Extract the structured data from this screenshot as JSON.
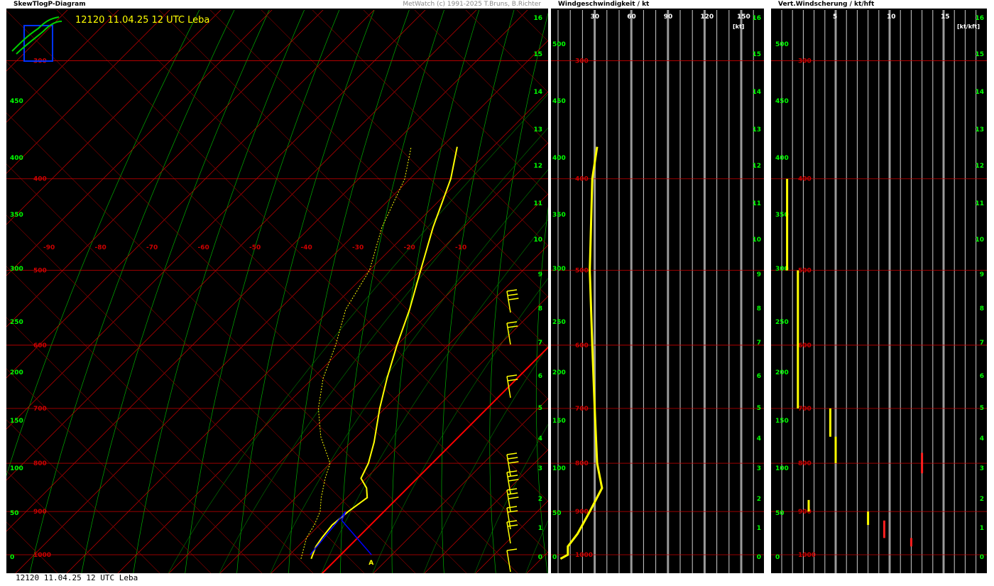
{
  "skewt": {
    "title": "SkewTlogP-Diagram",
    "copyright": "MetWatch (c) 1991-2025 T.Bruns, B.Richter",
    "station_title": "12120 11.04.25 12 UTC Leba"
  },
  "wind_panel": {
    "title": "Windgeschwindigkeit / kt"
  },
  "shear_panel": {
    "title": "Vert.Windscherung / kt/hft"
  },
  "footer": "12120 11.04.25 12 UTC Leba",
  "colors": {
    "isobar": "#cc0000",
    "isotherm": "#cc0000",
    "adiabat": "#00b000",
    "temp": "#ffff00",
    "dew": "#ffff00",
    "parcel": "#0000ff",
    "zero_iso": "#ff0000",
    "axis": "#00ff00"
  },
  "chart_data": [
    {
      "type": "line",
      "name": "skewt",
      "pressure_levels": [
        "200",
        "300",
        "400",
        "500",
        "600",
        "700",
        "800",
        "900",
        "1000"
      ],
      "temperature_labels": [
        "-90",
        "-80",
        "-70",
        "-60",
        "-50",
        "-40",
        "-30",
        "-20",
        "-10"
      ],
      "left_axis_labels": [
        "0",
        "50",
        "100",
        "150",
        "200",
        "250",
        "300",
        "350",
        "400",
        "450"
      ],
      "right_axis_labels": [
        "0",
        "1",
        "2",
        "3",
        "4",
        "5",
        "6",
        "7",
        "8",
        "9",
        "10",
        "11",
        "12",
        "13",
        "14",
        "15",
        "16"
      ],
      "parcel_label": "A",
      "temperature": [
        {
          "p": 1010,
          "t": -5
        },
        {
          "p": 1000,
          "t": -5.5
        },
        {
          "p": 980,
          "t": -6.5
        },
        {
          "p": 960,
          "t": -7
        },
        {
          "p": 930,
          "t": -7.5
        },
        {
          "p": 900,
          "t": -7
        },
        {
          "p": 870,
          "t": -6
        },
        {
          "p": 850,
          "t": -8
        },
        {
          "p": 830,
          "t": -11
        },
        {
          "p": 800,
          "t": -12.5
        },
        {
          "p": 760,
          "t": -15.5
        },
        {
          "p": 700,
          "t": -21
        },
        {
          "p": 650,
          "t": -25.5
        },
        {
          "p": 600,
          "t": -30
        },
        {
          "p": 550,
          "t": -34.5
        },
        {
          "p": 500,
          "t": -40
        },
        {
          "p": 450,
          "t": -46
        },
        {
          "p": 400,
          "t": -52
        },
        {
          "p": 370,
          "t": -57
        }
      ],
      "dewpoint": [
        {
          "p": 1010,
          "t": -7
        },
        {
          "p": 960,
          "t": -10
        },
        {
          "p": 930,
          "t": -11
        },
        {
          "p": 900,
          "t": -12.5
        },
        {
          "p": 870,
          "t": -15
        },
        {
          "p": 830,
          "t": -18
        },
        {
          "p": 800,
          "t": -20
        },
        {
          "p": 750,
          "t": -27
        },
        {
          "p": 700,
          "t": -33
        },
        {
          "p": 650,
          "t": -38
        },
        {
          "p": 600,
          "t": -42
        },
        {
          "p": 550,
          "t": -47
        },
        {
          "p": 500,
          "t": -50
        },
        {
          "p": 450,
          "t": -56
        },
        {
          "p": 400,
          "t": -61
        },
        {
          "p": 370,
          "t": -66
        }
      ]
    },
    {
      "type": "line",
      "name": "wind_speed",
      "x_ticks": [
        "30",
        "60",
        "90",
        "120",
        "150"
      ],
      "unit": "[kt]",
      "right_axis_labels": [
        "0",
        "1",
        "2",
        "3",
        "4",
        "5",
        "6",
        "7",
        "8",
        "9",
        "10",
        "11",
        "12",
        "13",
        "14",
        "15",
        "16"
      ],
      "left_axis_labels": [
        "0",
        "50",
        "100",
        "150",
        "200",
        "250",
        "300",
        "350",
        "400",
        "450",
        "500"
      ],
      "pressure_labels": [
        "200",
        "300",
        "400",
        "500",
        "600",
        "700",
        "800",
        "900",
        "1000"
      ],
      "speed": [
        {
          "p": 1010,
          "v": 2
        },
        {
          "p": 1000,
          "v": 8
        },
        {
          "p": 980,
          "v": 8
        },
        {
          "p": 950,
          "v": 16
        },
        {
          "p": 900,
          "v": 26
        },
        {
          "p": 850,
          "v": 36
        },
        {
          "p": 800,
          "v": 32
        },
        {
          "p": 700,
          "v": 30
        },
        {
          "p": 600,
          "v": 28
        },
        {
          "p": 500,
          "v": 26
        },
        {
          "p": 400,
          "v": 28
        },
        {
          "p": 370,
          "v": 32
        }
      ]
    },
    {
      "type": "bar",
      "name": "wind_shear",
      "x_ticks": [
        "5",
        "10",
        "15"
      ],
      "unit": "[kt/kft]",
      "right_axis_labels": [
        "0",
        "1",
        "2",
        "3",
        "4",
        "5",
        "6",
        "7",
        "8",
        "9",
        "10",
        "11",
        "12",
        "13",
        "14",
        "15",
        "16"
      ],
      "left_axis_labels": [
        "0",
        "50",
        "100",
        "150",
        "200",
        "250",
        "300",
        "350",
        "400",
        "450",
        "500"
      ],
      "pressure_labels": [
        "200",
        "300",
        "400",
        "500",
        "600",
        "700",
        "800",
        "900",
        "1000"
      ],
      "segments": [
        {
          "p1": 400,
          "p2": 500,
          "v": 0.5,
          "color": "yellow"
        },
        {
          "p1": 500,
          "p2": 700,
          "v": 1.5,
          "color": "yellow"
        },
        {
          "p1": 700,
          "p2": 750,
          "v": 4.5,
          "color": "yellow"
        },
        {
          "p1": 750,
          "p2": 800,
          "v": 5,
          "color": "yellow"
        },
        {
          "p1": 780,
          "p2": 820,
          "v": 13,
          "color": "red"
        },
        {
          "p1": 875,
          "p2": 900,
          "v": 2.5,
          "color": "yellow"
        },
        {
          "p1": 900,
          "p2": 930,
          "v": 8,
          "color": "yellow"
        },
        {
          "p1": 920,
          "p2": 960,
          "v": 9.5,
          "color": "red"
        },
        {
          "p1": 960,
          "p2": 980,
          "v": 12,
          "color": "red"
        }
      ]
    }
  ]
}
